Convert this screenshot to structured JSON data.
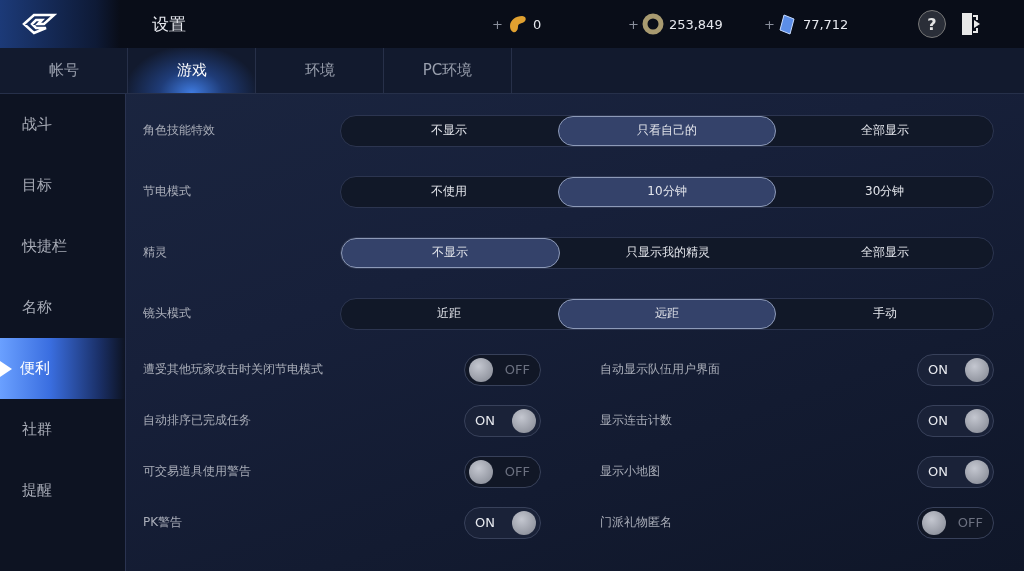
{
  "header": {
    "title": "设置",
    "currencies": [
      {
        "add": "+",
        "amount": "0",
        "kind": "bean"
      },
      {
        "add": "+",
        "amount": "253,849",
        "kind": "ring"
      },
      {
        "add": "+",
        "amount": "77,712",
        "kind": "crystal"
      }
    ],
    "help": "?"
  },
  "tabs": [
    {
      "label": "帐号",
      "selected": false
    },
    {
      "label": "游戏",
      "selected": true
    },
    {
      "label": "环境",
      "selected": false
    },
    {
      "label": "PC环境",
      "selected": false
    }
  ],
  "sidebar": {
    "items": [
      {
        "label": "战斗",
        "selected": false
      },
      {
        "label": "目标",
        "selected": false
      },
      {
        "label": "快捷栏",
        "selected": false
      },
      {
        "label": "名称",
        "selected": false
      },
      {
        "label": "便利",
        "selected": true
      },
      {
        "label": "社群",
        "selected": false
      },
      {
        "label": "提醒",
        "selected": false
      }
    ]
  },
  "segment_settings": [
    {
      "label": "角色技能特效",
      "options": [
        {
          "label": "不显示",
          "selected": false
        },
        {
          "label": "只看自己的",
          "selected": true
        },
        {
          "label": "全部显示",
          "selected": false
        }
      ]
    },
    {
      "label": "节电模式",
      "options": [
        {
          "label": "不使用",
          "selected": false
        },
        {
          "label": "10分钟",
          "selected": true
        },
        {
          "label": "30分钟",
          "selected": false
        }
      ]
    },
    {
      "label": "精灵",
      "options": [
        {
          "label": "不显示",
          "selected": true
        },
        {
          "label": "只显示我的精灵",
          "selected": false
        },
        {
          "label": "全部显示",
          "selected": false
        }
      ]
    },
    {
      "label": "镜头模式",
      "options": [
        {
          "label": "近距",
          "selected": false
        },
        {
          "label": "远距",
          "selected": true
        },
        {
          "label": "手动",
          "selected": false
        }
      ]
    }
  ],
  "toggles": [
    {
      "label": "遭受其他玩家攻击时关闭节电模式",
      "on": false,
      "value": "OFF"
    },
    {
      "label": "自动显示队伍用户界面",
      "on": true,
      "value": "ON"
    },
    {
      "label": "自动排序已完成任务",
      "on": true,
      "value": "ON"
    },
    {
      "label": "显示连击计数",
      "on": true,
      "value": "ON"
    },
    {
      "label": "可交易道具使用警告",
      "on": false,
      "value": "OFF"
    },
    {
      "label": "显示小地图",
      "on": true,
      "value": "ON"
    },
    {
      "label": "PK警告",
      "on": true,
      "value": "ON"
    },
    {
      "label": "门派礼物匿名",
      "on": false,
      "value": "OFF"
    }
  ]
}
